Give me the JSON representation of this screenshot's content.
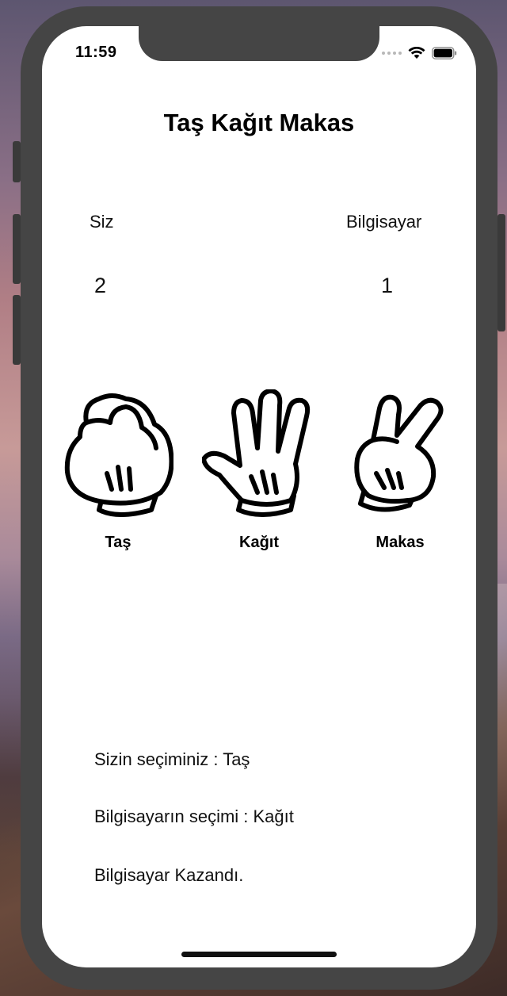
{
  "status_bar": {
    "time": "11:59"
  },
  "title": "Taş Kağıt Makas",
  "scoreboard": {
    "player_label": "Siz",
    "computer_label": "Bilgisayar",
    "player_score": "2",
    "computer_score": "1"
  },
  "choices": [
    {
      "label": "Taş",
      "icon": "fist-glove-icon"
    },
    {
      "label": "Kağıt",
      "icon": "open-hand-glove-icon"
    },
    {
      "label": "Makas",
      "icon": "victory-hand-glove-icon"
    }
  ],
  "results": {
    "player_choice": "Sizin seçiminiz : Taş",
    "computer_choice": "Bilgisayarın seçimi : Kağıt",
    "outcome": "Bilgisayar Kazandı."
  }
}
